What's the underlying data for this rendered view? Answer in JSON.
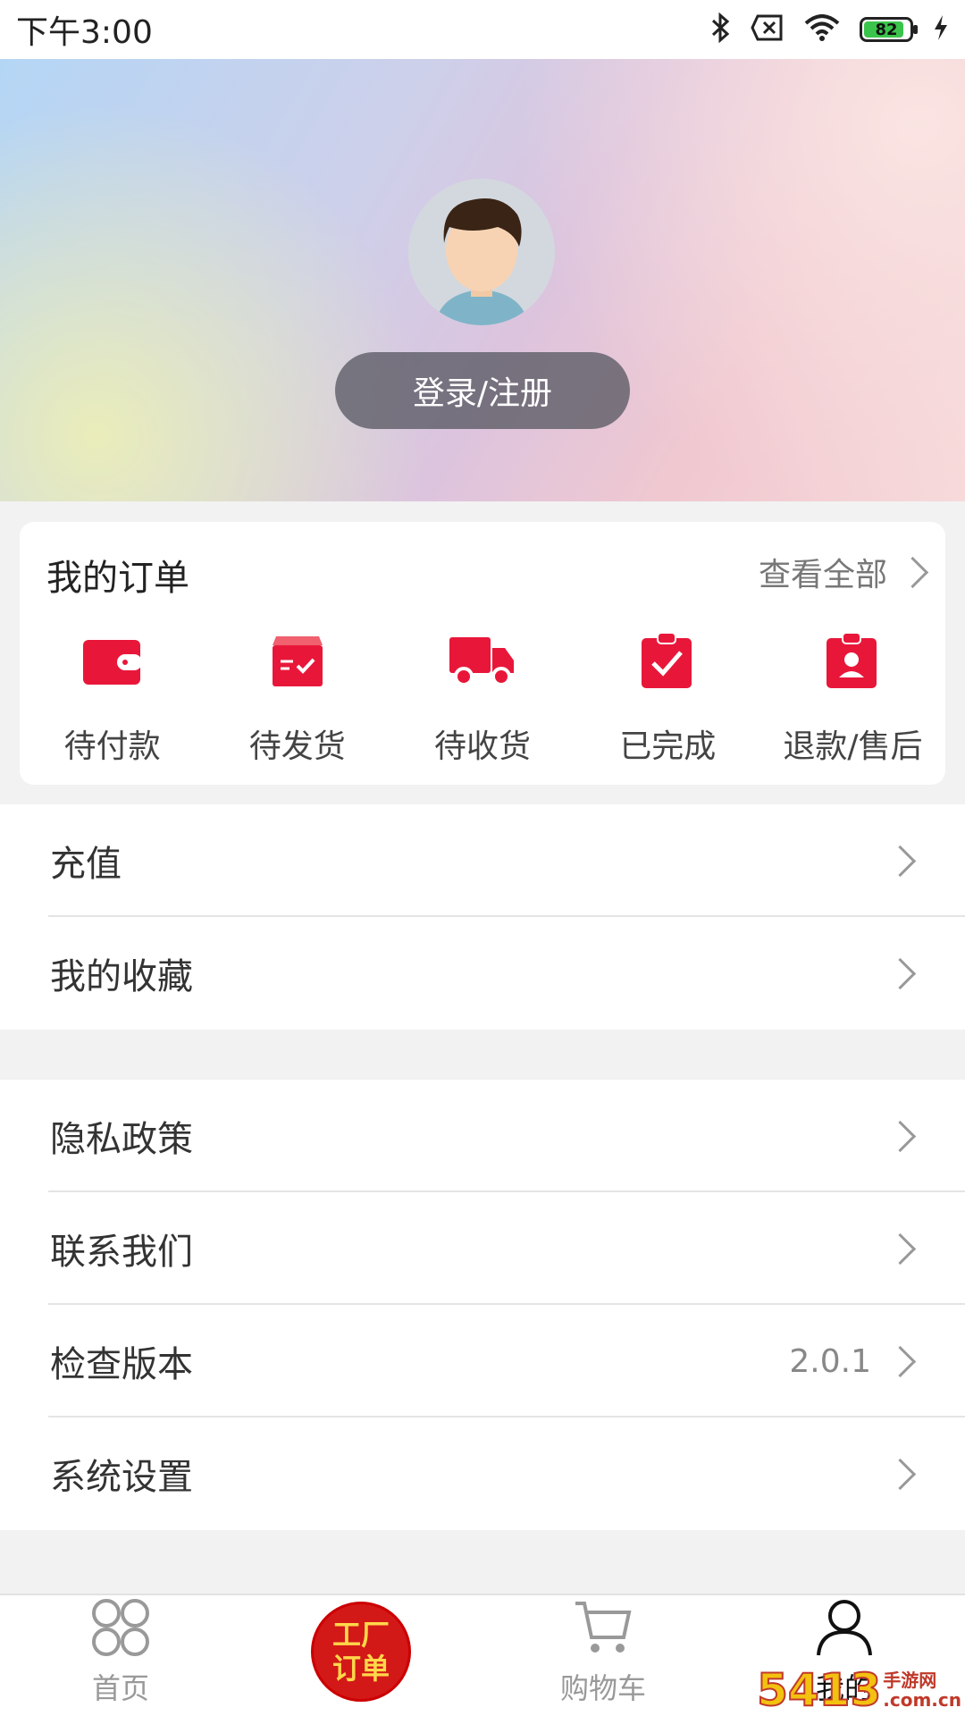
{
  "status_bar": {
    "time": "下午3:00",
    "battery": "82"
  },
  "profile": {
    "login_label": "登录/注册"
  },
  "orders": {
    "title": "我的订单",
    "view_all": "查看全部",
    "items": [
      {
        "label": "待付款",
        "icon": "wallet-icon"
      },
      {
        "label": "待发货",
        "icon": "package-icon"
      },
      {
        "label": "待收货",
        "icon": "truck-icon"
      },
      {
        "label": "已完成",
        "icon": "completed-clipboard-icon"
      },
      {
        "label": "退款/售后",
        "icon": "refund-clipboard-icon"
      }
    ],
    "accent_color": "#e8173a"
  },
  "menu_group_1": [
    {
      "label": "充值"
    },
    {
      "label": "我的收藏"
    }
  ],
  "menu_group_2": [
    {
      "label": "隐私政策"
    },
    {
      "label": "联系我们"
    },
    {
      "label": "检查版本",
      "value": "2.0.1"
    },
    {
      "label": "系统设置"
    }
  ],
  "tabbar": {
    "home": "首页",
    "factory_line1": "工厂",
    "factory_line2": "订单",
    "cart": "购物车",
    "mine": "我的"
  },
  "watermark": {
    "main": "5413",
    "sub1": "手游网",
    "sub2": ".com.cn"
  }
}
